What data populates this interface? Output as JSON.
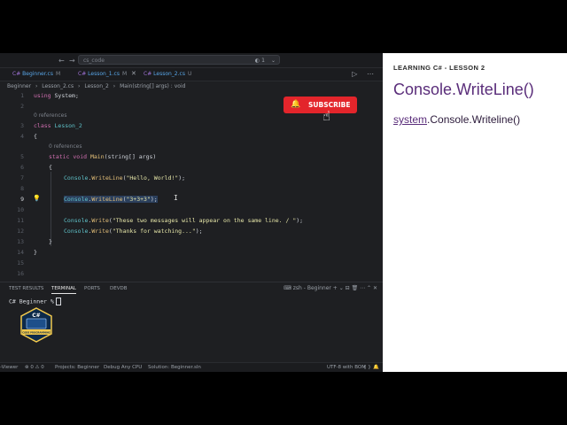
{
  "titlebar": {
    "back": "←",
    "forward": "→",
    "search_value": "cs_code",
    "search_dots": "◐",
    "search_count": "1",
    "search_chevron": "⌄"
  },
  "tabs": [
    {
      "label": "Beginner.cs",
      "mark": "M"
    },
    {
      "label": "Lesson_1.cs",
      "mark": "M"
    },
    {
      "label": "Lesson_2.cs",
      "mark": "U"
    }
  ],
  "tab_close": "✕",
  "editor_actions": "▷ ⋯",
  "breadcrumb": [
    "Beginner",
    "›",
    "Lesson_2.cs",
    "›",
    "Lesson_2",
    "›",
    "Main(string[] args) : void"
  ],
  "code": {
    "line_numbers": [
      "1",
      "2",
      "3",
      "4",
      "5",
      "6",
      "7",
      "8",
      "9",
      "10",
      "11",
      "12",
      "13",
      "14",
      "15",
      "16"
    ],
    "codelens_class": "0 references",
    "codelens_main": "0 references",
    "lines": {
      "l1_kw": "using",
      "l1_rest": " System;",
      "l3_kw": "class",
      "l3_name": " Lesson_2",
      "l4": "{",
      "l5_kw1": "static",
      "l5_kw2": " void",
      "l5_fn": " Main",
      "l5_rest": "(string[] args)",
      "l6": "{",
      "l7_cls": "Console",
      "l7_fn": "WriteLine",
      "l7_str": "\"Hello, World!\"",
      "l7_end": ");",
      "l9_cls": "Console",
      "l9_fn": "WriteLine",
      "l9_str": "\"3+3+3\"",
      "l9_end": ");",
      "l11_cls": "Console",
      "l11_fn": "Write",
      "l11_str": "\"These two messages will appear on the same line. / \"",
      "l11_end": ");",
      "l12_cls": "Console",
      "l12_fn": "Write",
      "l12_str": "\"Thanks for watching...\"",
      "l12_end": ");",
      "l13": "}",
      "l14": "}"
    }
  },
  "subscribe": {
    "label": "SUBSCRIBE",
    "bell": "🔔",
    "color": "#e3252b"
  },
  "panel": {
    "tabs": [
      "TEST RESULTS",
      "TERMINAL",
      "PORTS",
      "DEVDB"
    ],
    "shell_label": "zsh - Beginner",
    "tools": "+ ⌄ ⊟ 🗑 ⋯ ⌃ ✕",
    "prompt": "C# Beginner %"
  },
  "logo": {
    "text_top": "C#",
    "text_band": "CODE PROGRAMMING"
  },
  "statusbar": {
    "left_item": "-Viewer",
    "problems": "⊗ 0 ⚠ 0",
    "projects": "Projects: Beginner",
    "debug": "Debug Any CPU",
    "solution": "Solution: Beginner.sln",
    "encoding": "UTF-8 with BOM",
    "braces": "{ }",
    "bell": "🔔"
  },
  "lesson": {
    "heading": "LEARNING C# - LESSON 2",
    "title": "Console.WriteLine()",
    "code_prefix": "system",
    "code_rest": ".Console.Writeline()"
  }
}
